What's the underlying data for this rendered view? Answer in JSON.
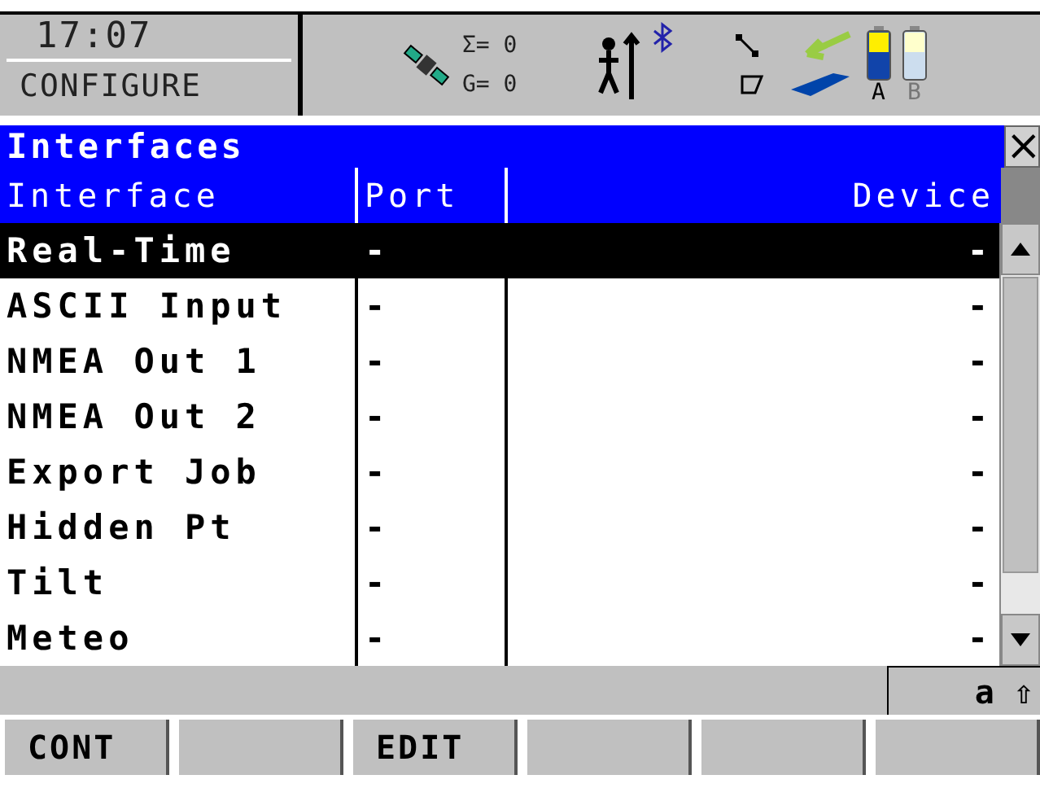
{
  "status": {
    "time": "17:07",
    "mode": "CONFIGURE",
    "satellites_total": "Σ= 0",
    "satellites_glonass": "G= 0",
    "batteries": [
      {
        "label": "A",
        "disabled": false
      },
      {
        "label": "B",
        "disabled": true
      }
    ]
  },
  "window": {
    "title": "Interfaces",
    "close": "×"
  },
  "table": {
    "columns": [
      "Interface",
      "Port",
      "Device"
    ],
    "rows": [
      {
        "interface": "Real-Time",
        "port": "-",
        "device": "-",
        "selected": true
      },
      {
        "interface": "ASCII Input",
        "port": "-",
        "device": "-",
        "selected": false
      },
      {
        "interface": "NMEA Out 1",
        "port": "-",
        "device": "-",
        "selected": false
      },
      {
        "interface": "NMEA Out 2",
        "port": "-",
        "device": "-",
        "selected": false
      },
      {
        "interface": "Export Job",
        "port": "-",
        "device": "-",
        "selected": false
      },
      {
        "interface": "Hidden Pt",
        "port": "-",
        "device": "-",
        "selected": false
      },
      {
        "interface": "Tilt",
        "port": "-",
        "device": "-",
        "selected": false
      },
      {
        "interface": "Meteo",
        "port": "-",
        "device": "-",
        "selected": false
      }
    ]
  },
  "input_mode": {
    "case": "a",
    "shift": "⇧"
  },
  "softkeys": [
    {
      "kind": "labeled",
      "label": "CONT"
    },
    {
      "kind": "blank"
    },
    {
      "kind": "labeled",
      "label": "EDIT"
    },
    {
      "kind": "blank"
    },
    {
      "kind": "blank"
    },
    {
      "kind": "blank"
    }
  ]
}
